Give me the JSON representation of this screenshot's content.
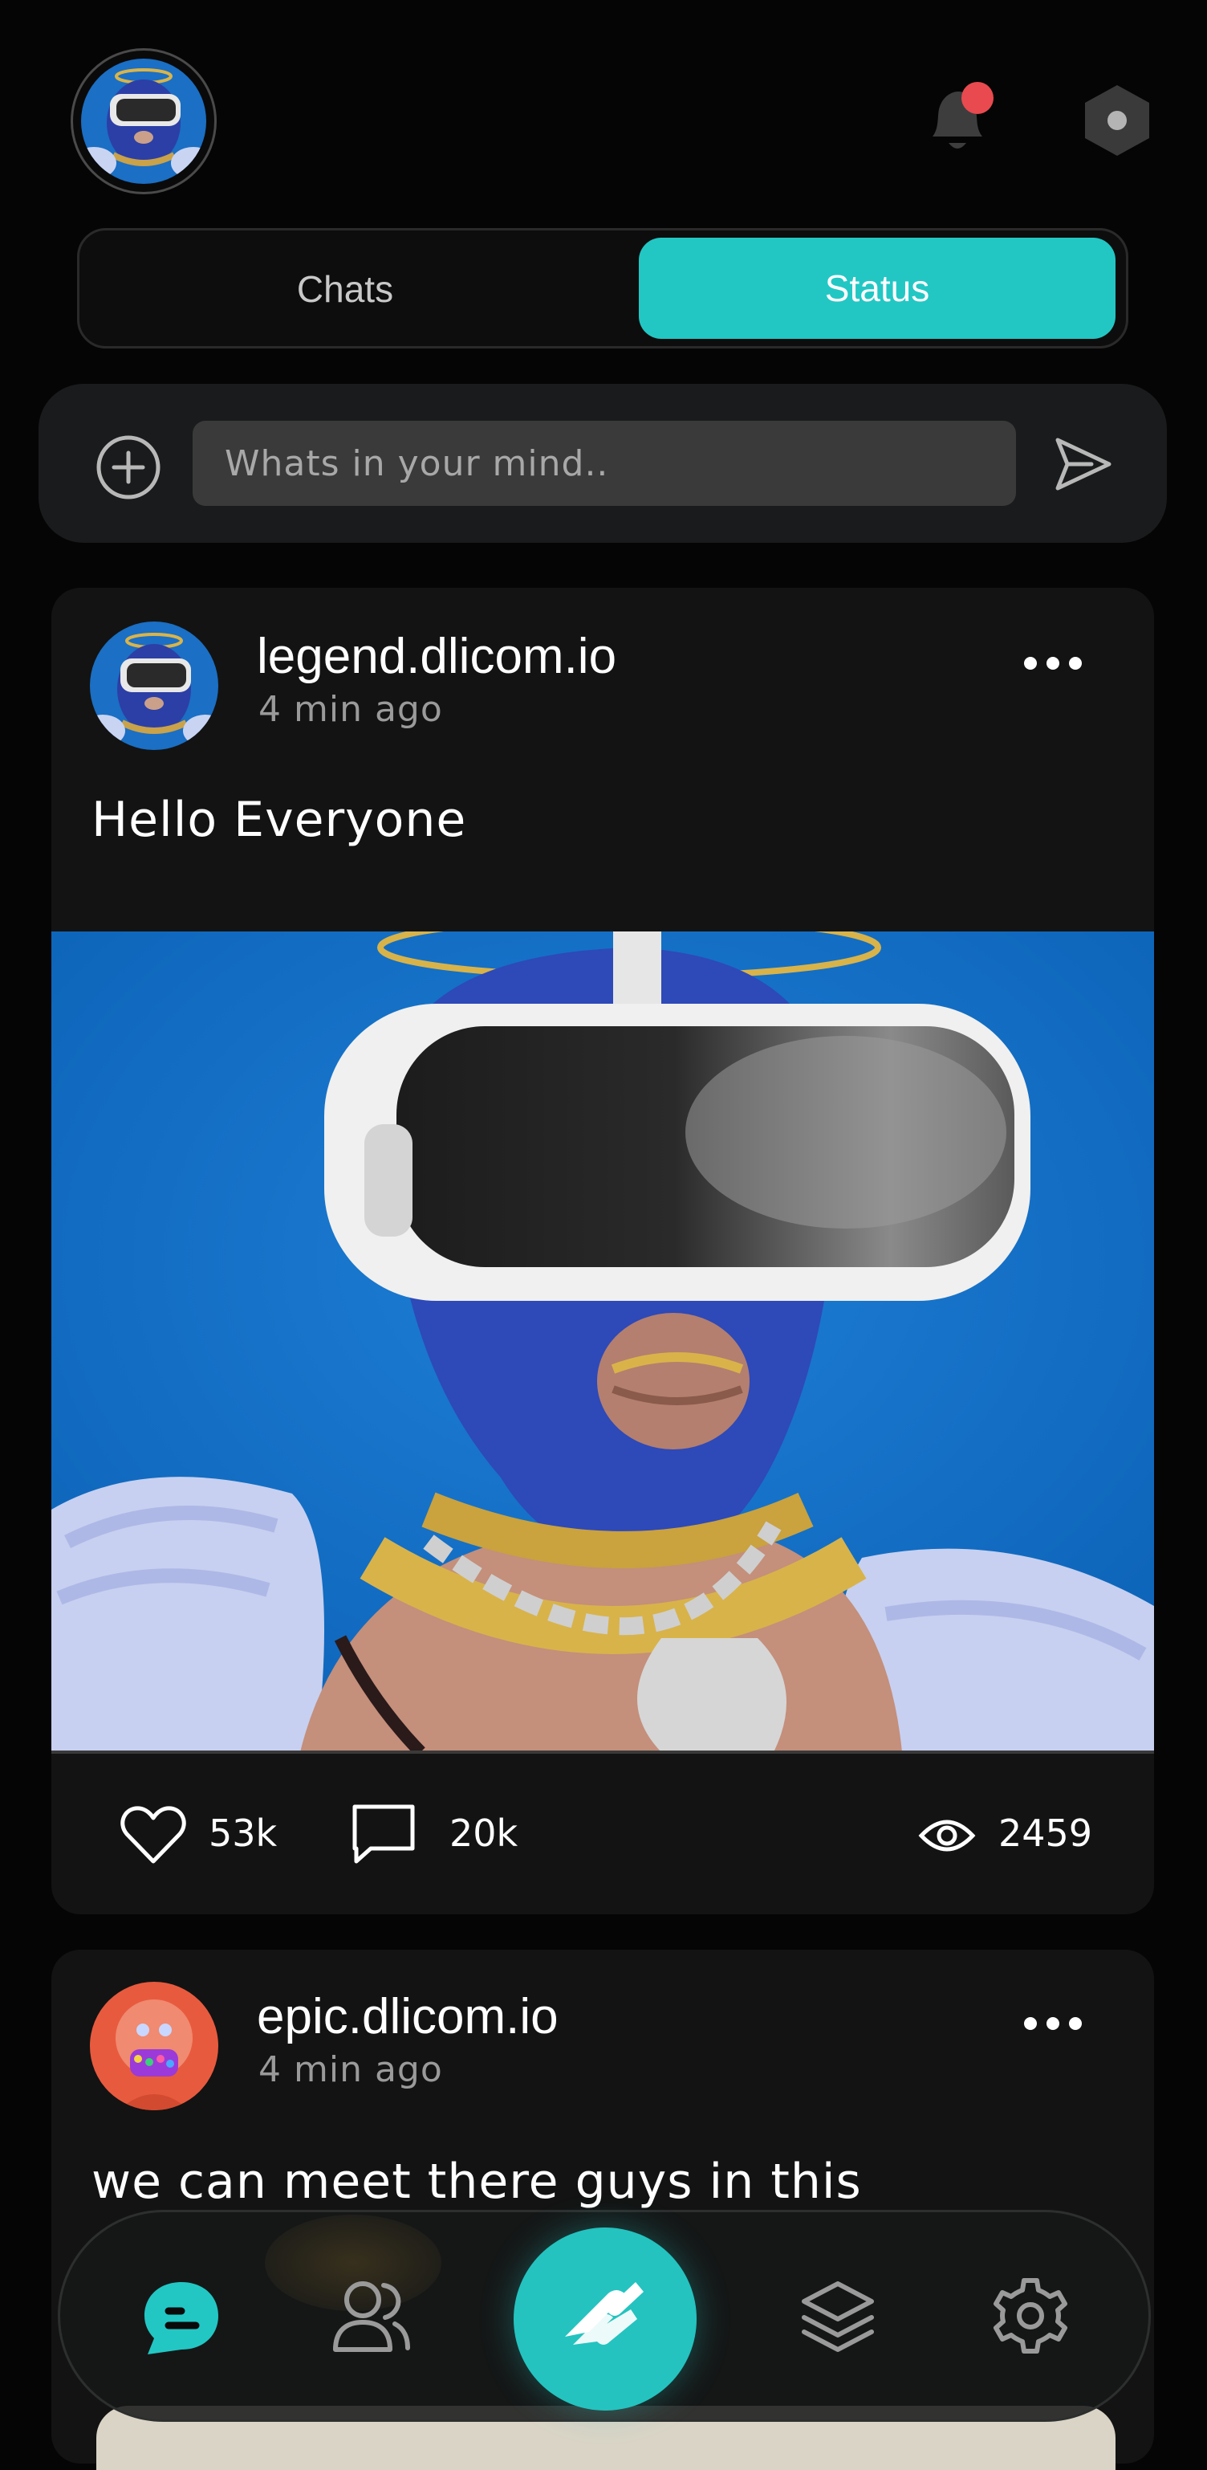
{
  "header": {
    "avatar_icon": "profile-avatar",
    "notification_icon": "bell-icon",
    "notification_badge_color": "#e84a4f",
    "settings_icon": "hexagon-icon"
  },
  "tabs": [
    {
      "label": "Chats",
      "active": false
    },
    {
      "label": "Status",
      "active": true
    }
  ],
  "accent_color": "#22c7c4",
  "composer": {
    "placeholder": "Whats in your mind..",
    "value": "",
    "add_icon": "plus-circle-icon",
    "send_icon": "send-icon"
  },
  "posts": [
    {
      "username": "legend.dlicom.io",
      "time": "4 min ago",
      "text": "Hello Everyone",
      "likes": "53k",
      "comments": "20k",
      "views": "2459"
    },
    {
      "username": "epic.dlicom.io",
      "time": "4 min ago",
      "text": "we can meet there guys in this"
    }
  ],
  "nav": {
    "items": [
      "chat-icon",
      "people-icon",
      "logo-icon",
      "layers-icon",
      "gear-icon"
    ],
    "active": "chat-icon"
  }
}
